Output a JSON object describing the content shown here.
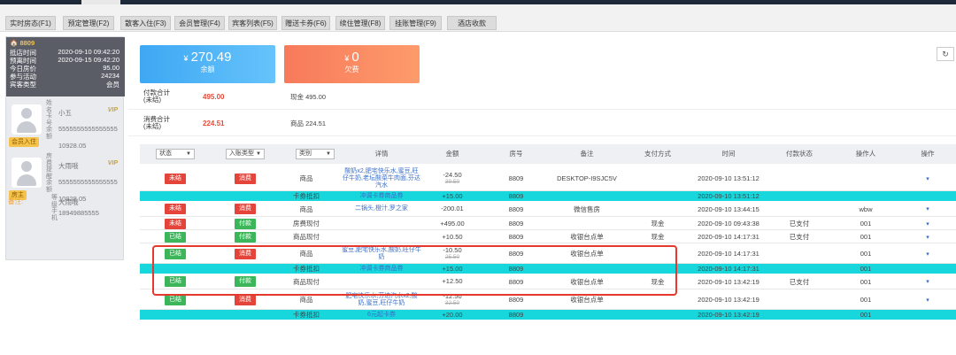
{
  "tabs": [
    {
      "label": "实时房态(F1)"
    },
    {
      "label": "预定管理(F2)"
    },
    {
      "label": "散客入住(F3)"
    },
    {
      "label": "会员管理(F4)"
    },
    {
      "label": "宾客列表(F5)"
    },
    {
      "label": "赠送卡券(F6)"
    },
    {
      "label": "续住管理(F8)"
    },
    {
      "label": "挂账管理(F9)"
    },
    {
      "label": "酒店收款"
    }
  ],
  "room": {
    "number": "8809",
    "fields": [
      {
        "label": "抵店时间",
        "value": "2020-09-10 09:42:20"
      },
      {
        "label": "预离时间",
        "value": "2020-09-15 09:42:20"
      },
      {
        "label": "今日房价",
        "value": "95.00"
      },
      {
        "label": "参与活动",
        "value": "24234"
      },
      {
        "label": "宾客类型",
        "value": "会员"
      }
    ]
  },
  "guests": [
    {
      "vertical_label": "姓名卡号余额",
      "name": "小五",
      "vip": "VIP",
      "card": "5555555555555555",
      "balance": "10928.05",
      "badge": "会员入住"
    },
    {
      "vertical_label": "房费提醒余额",
      "name": "大雨哦",
      "vip": "VIP",
      "card": "5555555555555555",
      "balance": "10928.05",
      "badge": "房主"
    }
  ],
  "guest_extra": {
    "vertical_label": "等级手机",
    "level": "大雨哦",
    "phone": "18949885555"
  },
  "note_label": "备注:",
  "balance_box": {
    "currency": "¥",
    "amount": "270.49",
    "caption": "余额"
  },
  "owe_box": {
    "currency": "¥",
    "amount": "0",
    "caption": "欠费"
  },
  "refresh_icon": "↻",
  "summary": [
    {
      "label": "付款合计\n(未结)",
      "value": "495.00",
      "detail": "现金 495.00"
    },
    {
      "label": "消费合计\n(未结)",
      "value": "224.51",
      "detail": "商品 224.51"
    }
  ],
  "table": {
    "headers": {
      "status": "状态",
      "entry_type": "入账类型",
      "category": "类别",
      "detail": "详情",
      "amount": "金额",
      "room": "房号",
      "remark": "备注",
      "pay_method": "支付方式",
      "time": "时间",
      "pay_status": "付款状态",
      "operator": "操作人",
      "action": "操作"
    },
    "rows": [
      {
        "status": "未结",
        "status_color": "#e5443a",
        "entry": "消费",
        "entry_color": "#e5443a",
        "category": "商品",
        "detail": "酸奶x2,肥宅快乐水,蜜豆,旺仔牛奶,老坛酸菜牛肉面,芬达汽水",
        "amount": "-24.50",
        "orig": "39.50",
        "room": "8809",
        "remark": "DESKTOP-I9SJC5V",
        "pay": "",
        "time": "2020-09-10 13:51:12",
        "pay_status": "",
        "operator": "",
        "drop": true,
        "cyan": false
      },
      {
        "status": "",
        "entry": "",
        "category": "卡券抵扣",
        "detail": "冲调卡券商品券",
        "amount": "+15.00",
        "orig": "",
        "room": "8809",
        "remark": "",
        "pay": "",
        "time": "2020-09-10 13:51:12",
        "pay_status": "",
        "operator": "",
        "drop": false,
        "cyan": true
      },
      {
        "status": "未结",
        "status_color": "#e5443a",
        "entry": "消费",
        "entry_color": "#e5443a",
        "category": "商品",
        "detail": "二锅头,橙汁,罗之家",
        "amount": "-200.01",
        "orig": "",
        "room": "8809",
        "remark": "微信售房",
        "pay": "",
        "time": "2020-09-10 13:44:15",
        "pay_status": "",
        "operator": "wbw",
        "drop": true,
        "cyan": false
      },
      {
        "status": "未结",
        "status_color": "#e5443a",
        "entry": "付款",
        "entry_color": "#3db55a",
        "category": "房费现付",
        "detail": "",
        "amount": "+495.00",
        "orig": "",
        "room": "8809",
        "remark": "",
        "pay": "现金",
        "time": "2020-09-10 09:43:38",
        "pay_status": "已支付",
        "operator": "001",
        "drop": true,
        "cyan": false
      },
      {
        "status": "已结",
        "status_color": "#3db55a",
        "entry": "付款",
        "entry_color": "#3db55a",
        "category": "商品现付",
        "detail": "",
        "amount": "+10.50",
        "orig": "",
        "room": "8809",
        "remark": "收银台点单",
        "pay": "现金",
        "time": "2020-09-10 14:17:31",
        "pay_status": "已支付",
        "operator": "001",
        "drop": true,
        "cyan": false
      },
      {
        "status": "已结",
        "status_color": "#3db55a",
        "entry": "消费",
        "entry_color": "#e5443a",
        "category": "商品",
        "detail": "蜜豆,肥宅快乐水,酸奶,旺仔牛奶",
        "amount": "-10.50",
        "orig": "25.50",
        "room": "8809",
        "remark": "收银台点单",
        "pay": "",
        "time": "2020-09-10 14:17:31",
        "pay_status": "",
        "operator": "001",
        "drop": true,
        "cyan": false
      },
      {
        "status": "",
        "entry": "",
        "category": "卡券抵扣",
        "detail": "冲调卡券商品券",
        "amount": "+15.00",
        "orig": "",
        "room": "8809",
        "remark": "",
        "pay": "",
        "time": "2020-09-10 14:17:31",
        "pay_status": "",
        "operator": "001",
        "drop": false,
        "cyan": true
      },
      {
        "status": "已结",
        "status_color": "#3db55a",
        "entry": "付款",
        "entry_color": "#3db55a",
        "category": "商品现付",
        "detail": "",
        "amount": "+12.50",
        "orig": "",
        "room": "8809",
        "remark": "收银台点单",
        "pay": "现金",
        "time": "2020-09-10 13:42:19",
        "pay_status": "已支付",
        "operator": "001",
        "drop": true,
        "cyan": false
      },
      {
        "status": "已结",
        "status_color": "#3db55a",
        "entry": "消费",
        "entry_color": "#e5443a",
        "category": "商品",
        "detail": "肥宅快乐水,芬达汽水x2,酸奶,蜜豆,旺仔牛奶",
        "amount": "-12.50",
        "orig": "32.50",
        "room": "8809",
        "remark": "收银台点单",
        "pay": "",
        "time": "2020-09-10 13:42:19",
        "pay_status": "",
        "operator": "001",
        "drop": true,
        "cyan": false
      },
      {
        "status": "",
        "entry": "",
        "category": "卡券抵扣",
        "detail": "6元起卡券",
        "amount": "+20.00",
        "orig": "",
        "room": "8809",
        "remark": "",
        "pay": "",
        "time": "2020-09-10 13:42:19",
        "pay_status": "",
        "operator": "001",
        "drop": false,
        "cyan": true
      }
    ]
  },
  "dropdown_icon": "▾"
}
